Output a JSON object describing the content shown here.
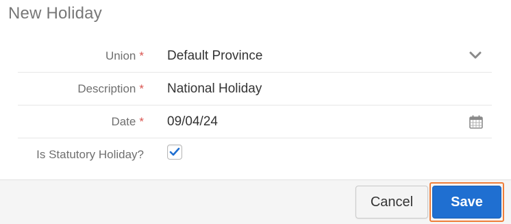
{
  "dialog": {
    "title": "New Holiday"
  },
  "form": {
    "union": {
      "label": "Union",
      "required_marker": "*",
      "value": "Default Province",
      "icon": "chevron-down-icon"
    },
    "description": {
      "label": "Description",
      "required_marker": "*",
      "value": "National Holiday"
    },
    "date": {
      "label": "Date",
      "required_marker": "*",
      "value": "09/04/24",
      "icon": "calendar-icon"
    },
    "is_statutory": {
      "label": "Is Statutory Holiday?",
      "checked": true
    }
  },
  "footer": {
    "cancel_label": "Cancel",
    "save_label": "Save"
  },
  "colors": {
    "primary": "#1f6fd1",
    "required": "#d9534f",
    "focus_outline": "#f07e3a",
    "check": "#1f6fd1"
  }
}
